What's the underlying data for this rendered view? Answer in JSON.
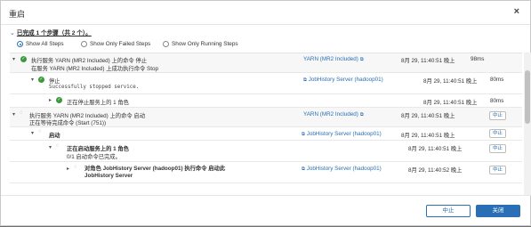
{
  "dialog": {
    "title": "重启",
    "close_glyph": "×",
    "summary": "已完成 1 个步骤（共 2 个）。"
  },
  "filters": [
    {
      "label": "Show All Steps",
      "selected": true
    },
    {
      "label": "Show Only Failed Steps",
      "selected": false
    },
    {
      "label": "Show Only Running Steps",
      "selected": false
    }
  ],
  "rows": [
    {
      "title": "执行服务 YARN (MR2 Included) 上的命令 停止",
      "detail": "在服务 YARN (MR2 Included) 上成功执行命令 Stop",
      "context": "YARN (MR2 Included)",
      "time": "8月 29, 11:40:51 晚上",
      "duration": "98ms",
      "status": "success"
    },
    {
      "title": "停止",
      "detail": "Successfully stopped service.",
      "context": "JobHistory Server (hadoop01)",
      "time": "8月 29, 11:40:51 晚上",
      "duration": "80ms",
      "status": "success"
    },
    {
      "title": "正在停止服务上的 1 角色",
      "time": "8月 29, 11:40:51 晚上",
      "duration": "80ms",
      "status": "success"
    },
    {
      "title": "执行服务 YARN (MR2 Included) 上的命令 启动",
      "detail": "正在等待完成命令 (Start (751))",
      "context": "YARN (MR2 Included)",
      "time": "8月 29, 11:40:51 晚上",
      "action": "中止",
      "status": "running"
    },
    {
      "title": "启动",
      "context": "JobHistory Server (hadoop01)",
      "time": "8月 29, 11:40:51 晚上",
      "action": "中止",
      "status": "running"
    },
    {
      "title": "正在启动服务上的 1 角色",
      "detail": "0/1 启动命令已完成。",
      "time": "8月 29, 11:40:51 晚上",
      "action": "中止",
      "status": "running"
    },
    {
      "title": "对角色 JobHistory Server (hadoop01) 执行命令 启动此 JobHistory Server",
      "context": "JobHistory Server (hadoop01)",
      "time": "8月 29, 11:40:52 晚上",
      "action": "中止",
      "status": "running"
    }
  ],
  "footer": {
    "abort_label": "中止",
    "close_label": "关闭"
  },
  "colors": {
    "accent": "#2a6fb5",
    "success": "#3a9a3a"
  },
  "icons": {
    "expand": "chevron-down-icon",
    "collapse": "chevron-right-icon",
    "success": "check-circle-icon",
    "running": "spinner-icon",
    "external": "external-link-icon"
  }
}
